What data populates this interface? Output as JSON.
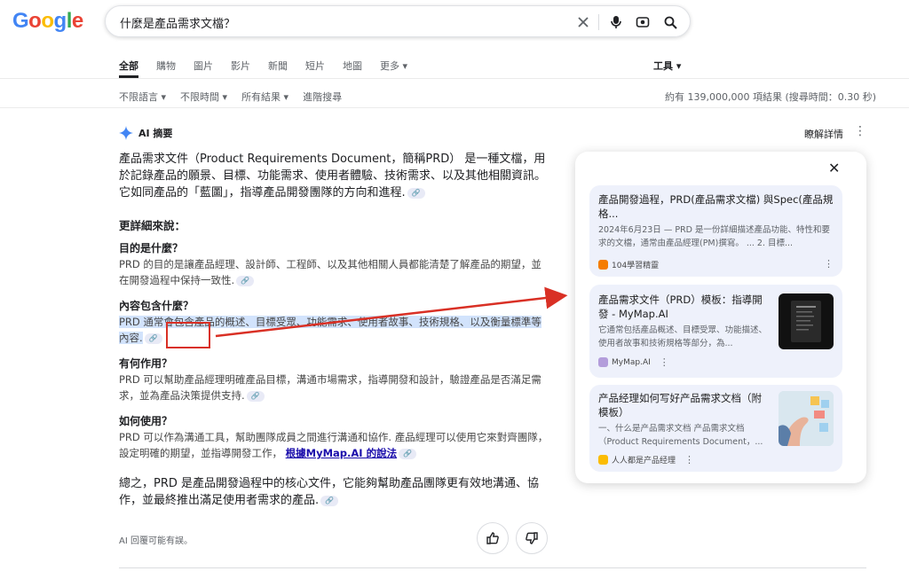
{
  "logo": "Google",
  "search": {
    "query": "什麼是產品需求文檔？"
  },
  "icons": {
    "clear": "close-icon",
    "voice": "mic-icon",
    "lens": "lens-icon",
    "search": "search-icon"
  },
  "tabs": [
    "全部",
    "購物",
    "圖片",
    "影片",
    "新聞",
    "短片",
    "地圖",
    "更多 ▾"
  ],
  "tools_label": "工具 ▾",
  "filters": [
    "不限語言 ▾",
    "不限時間 ▾",
    "所有結果 ▾",
    "進階搜尋"
  ],
  "stats": "約有 139,000,000 項結果 (搜尋時間：0.30 秒)",
  "ai": {
    "title": "AI 摘要",
    "learn_more": "瞭解詳情",
    "intro": "產品需求文件（Product Requirements Document，簡稱PRD） 是一種文檔，用於記錄產品的願景、目標、功能需求、使用者體驗、技術需求、以及其他相關資訊。 它如同產品的「藍圖」，指導產品開發團隊的方向和進程.",
    "detail_heading": "更詳細來說：",
    "sections": [
      {
        "heading": "目的是什麼？",
        "body": "PRD 的目的是讓產品經理、設計師、工程師、以及其他相關人員都能清楚了解產品的期望，並在開發過程中保持一致性."
      },
      {
        "heading": "內容包含什麼？",
        "body": "PRD 通常會包含產品的概述、目標受眾、功能需求、使用者故事、技術規格、以及衡量標準等內容."
      },
      {
        "heading": "有何作用？",
        "body": "PRD 可以幫助產品經理明確產品目標，溝通市場需求，指導開發和設計，驗證產品是否滿足需求，並為產品決策提供支持."
      },
      {
        "heading": "如何使用？",
        "body": "PRD 可以作為溝通工具，幫助團隊成員之間進行溝通和協作. 產品經理可以使用它來對齊團隊，設定明確的期望，並指導開發工作，",
        "link": "根據MyMap.AI 的說法"
      }
    ],
    "conclusion": "總之，PRD 是產品開發過程中的核心文件，它能夠幫助產品團隊更有效地溝通、協作，並最終推出滿足使用者需求的產品.",
    "disclaimer": "AI 回覆可能有誤。"
  },
  "panel": {
    "cards": [
      {
        "title": "產品開發過程，PRD(產品需求文檔) 與Spec(產品規格...",
        "desc": "2024年6月23日 — PRD 是一份詳細描述產品功能、特性和要求的文檔，通常由產品經理(PM)撰寫。 ... 2. 目標...",
        "source": "104學習精靈",
        "fav_color": "#f57c00"
      },
      {
        "title": "產品需求文件（PRD）模板：指導開發 - MyMap.AI",
        "desc": "它通常包括產品概述、目標受眾、功能描述、使用者故事和技術規格等部分，為...",
        "source": "MyMap.AI",
        "fav_color": "#b39ddb"
      },
      {
        "title": "产品经理如何写好产品需求文档（附模板）",
        "desc": "一、什么是产品需求文档 产品需求文档（Product Requirements Document，...",
        "source": "人人都是产品经理",
        "fav_color": "#fbbc04"
      }
    ]
  },
  "colors": {
    "link_blue": "#1a0dab",
    "annotation_red": "#d93025",
    "card_bg": "#eef1fb"
  }
}
